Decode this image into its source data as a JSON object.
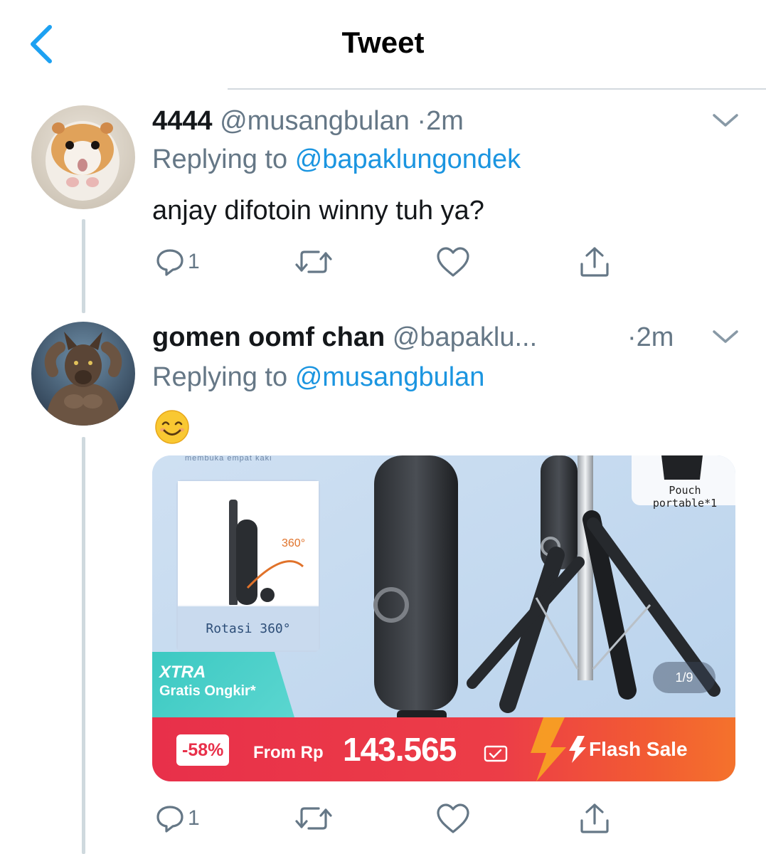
{
  "header": {
    "title": "Tweet"
  },
  "tweets": [
    {
      "display_name": "4444",
      "handle": "@musangbulan",
      "dot": "·",
      "time": "2m",
      "replying_prefix": "Replying to",
      "replying_to": "@bapaklungondek",
      "text": "anjay difotoin winny tuh ya?",
      "reply_count": "1",
      "avatar_icon": "hamster-avatar"
    },
    {
      "display_name": "gomen oomf chan",
      "handle": "@bapaklu...",
      "dot": "·",
      "time": "2m",
      "replying_prefix": "Replying to",
      "replying_to": "@musangbulan",
      "emoji": "smiling-face-emoji",
      "reply_count": "1",
      "avatar_icon": "werewolf-avatar",
      "media": {
        "inset_top_label": "membuka empat kaki",
        "rotation_label": "360°",
        "inset_caption": "Rotasi 360°",
        "pouch_label": "Pouch portable*1",
        "xtra_title": "XTRA",
        "xtra_subtitle": "Gratis Ongkir*",
        "slide_counter": "1/9",
        "discount": "-58%",
        "from_label": "From Rp",
        "price": "143.565",
        "flash_sale": "Flash Sale",
        "colors": {
          "sale_red": "#e8304a",
          "sale_orange": "#f4722c",
          "xtra_teal": "#3cc9c2"
        }
      }
    }
  ],
  "colors": {
    "link_blue": "#1b95e0",
    "muted_gray": "#657786",
    "thread_line": "#cfd9de"
  }
}
